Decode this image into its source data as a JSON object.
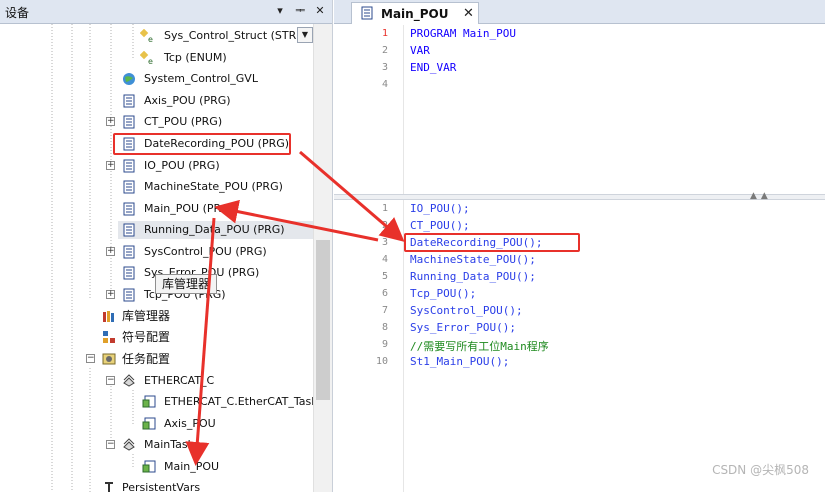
{
  "panel": {
    "title": "设备",
    "controls": {
      "dropdown": "▾",
      "pin": "ᆍ",
      "close": "✕"
    }
  },
  "tree": {
    "items": [
      {
        "label": "Sys_Control_Struct (STRUC",
        "icon": "struct-icon"
      },
      {
        "label": "Tcp (ENUM)",
        "icon": "enum-icon"
      },
      {
        "label": "System_Control_GVL",
        "icon": "globe-icon"
      },
      {
        "label": "Axis_POU (PRG)",
        "icon": "pou-icon"
      },
      {
        "label": "CT_POU (PRG)",
        "icon": "pou-icon",
        "expander": "+"
      },
      {
        "label": "DateRecording_POU (PRG)",
        "icon": "pou-icon"
      },
      {
        "label": "IO_POU (PRG)",
        "icon": "pou-icon",
        "expander": "+"
      },
      {
        "label": "MachineState_POU (PRG)",
        "icon": "pou-icon"
      },
      {
        "label": "Main_POU (PRG)",
        "icon": "pou-icon"
      },
      {
        "label": "Running_Data_POU (PRG)",
        "icon": "pou-icon"
      },
      {
        "label": "SysControl_POU (PRG)",
        "icon": "pou-icon",
        "expander": "+"
      },
      {
        "label": "Sys_Error_POU (PRG)",
        "icon": "pou-icon"
      },
      {
        "label": "Tcp_POU (PRG)",
        "icon": "pou-icon",
        "expander": "+"
      },
      {
        "label": "库管理器",
        "icon": "library-icon"
      },
      {
        "label": "符号配置",
        "icon": "symbol-config-icon"
      },
      {
        "label": "任务配置",
        "icon": "task-config-icon",
        "expander": "−"
      },
      {
        "label": "ETHERCAT_C",
        "icon": "task-icon",
        "expander": "−"
      },
      {
        "label": "ETHERCAT_C.EtherCAT_Task",
        "icon": "task-call-icon"
      },
      {
        "label": "Axis_POU",
        "icon": "task-call-icon"
      },
      {
        "label": "MainTask",
        "icon": "task-icon",
        "expander": "−"
      },
      {
        "label": "Main_POU",
        "icon": "task-call-icon"
      },
      {
        "label": "PersistentVars",
        "icon": "persistent-icon"
      }
    ],
    "tooltip": "库管理器"
  },
  "editor": {
    "tab_label": "Main_POU",
    "declaration": {
      "line_numbers": [
        "1",
        "2",
        "3",
        "4"
      ],
      "lines": [
        "PROGRAM Main_POU",
        "VAR",
        "END_VAR",
        ""
      ]
    },
    "body": {
      "line_numbers": [
        "1",
        "2",
        "3",
        "4",
        "5",
        "6",
        "7",
        "8",
        "9",
        "10"
      ],
      "lines": [
        "IO_POU();",
        "CT_POU();",
        "DateRecording_POU();",
        "MachineState_POU();",
        "Running_Data_POU();",
        "Tcp_POU();",
        "SysControl_POU();",
        "Sys_Error_POU();",
        "//需要写所有工位Main程序",
        "St1_Main_POU();"
      ]
    }
  },
  "watermark": "CSDN @尖枫508",
  "colors": {
    "highlight_red": "#e8312b",
    "keyword_blue": "#1400ff",
    "call_blue": "#2a3ee8",
    "comment_green": "#1f8a1f"
  }
}
